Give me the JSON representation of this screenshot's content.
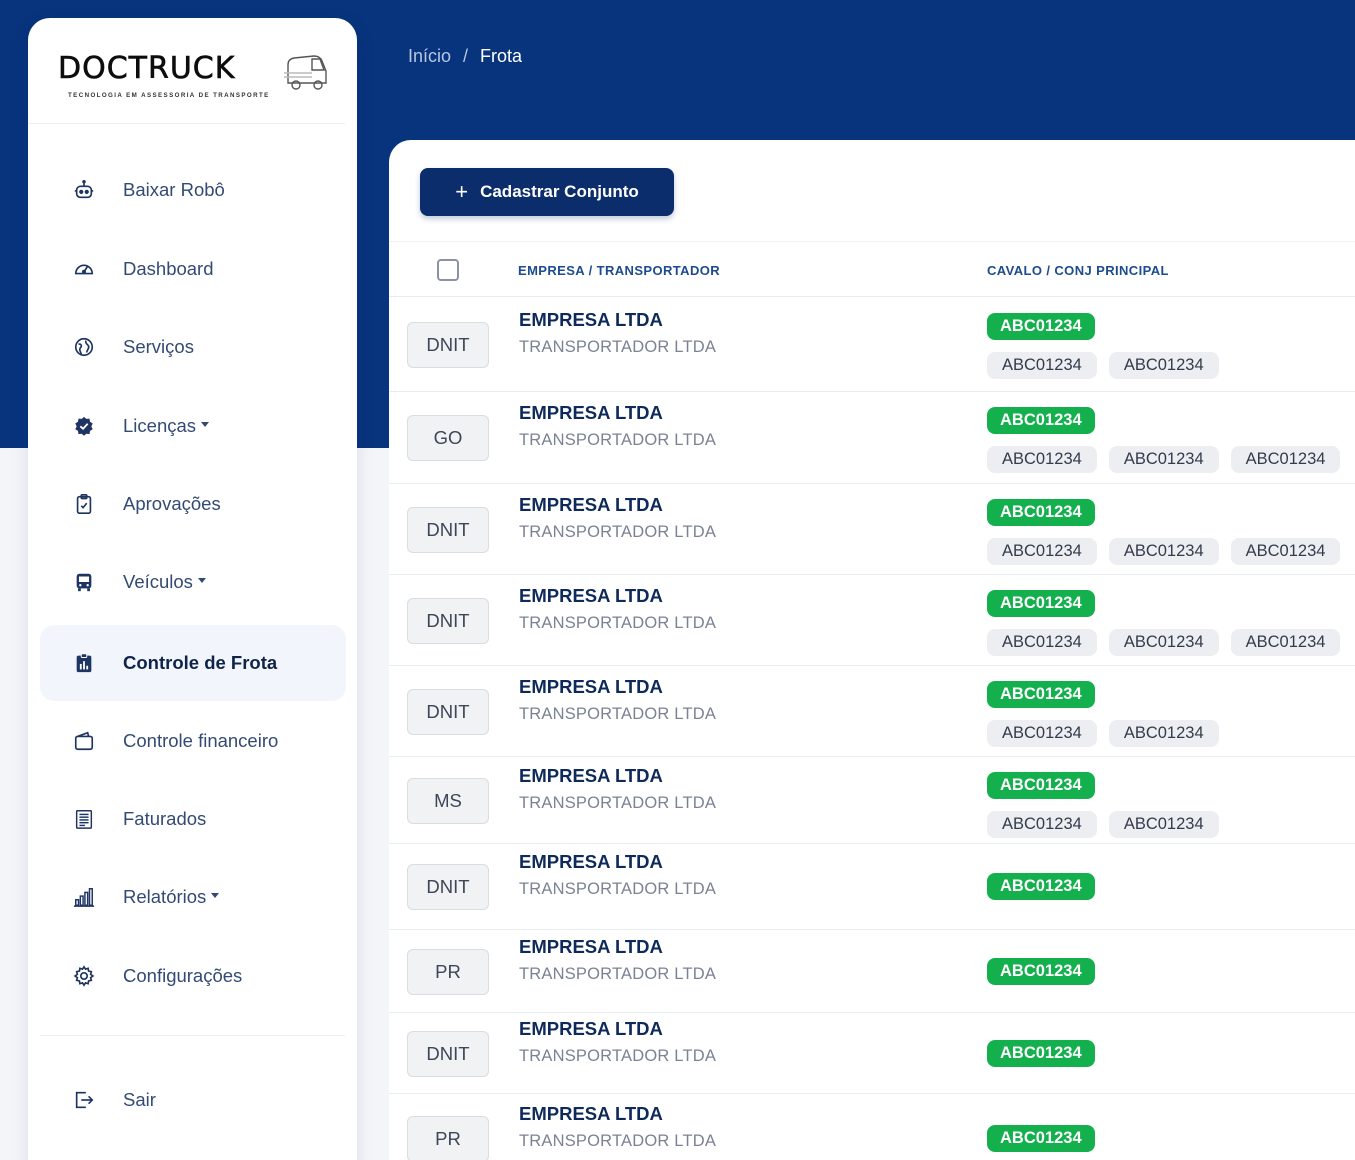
{
  "logo": {
    "name": "DOCTRUCK",
    "tagline": "TECNOLOGIA EM ASSESSORIA DE TRANSPORTE"
  },
  "breadcrumb": {
    "home": "Início",
    "separator": "/",
    "current": "Frota"
  },
  "sidebar": {
    "items": [
      {
        "label": "Baixar Robô",
        "icon": "robot-icon",
        "dropdown": false,
        "active": false
      },
      {
        "label": "Dashboard",
        "icon": "gauge-icon",
        "dropdown": false,
        "active": false
      },
      {
        "label": "Serviços",
        "icon": "globe-icon",
        "dropdown": false,
        "active": false
      },
      {
        "label": "Licenças",
        "icon": "badge-check-icon",
        "dropdown": true,
        "active": false
      },
      {
        "label": "Aprovações",
        "icon": "clipboard-check-icon",
        "dropdown": false,
        "active": false
      },
      {
        "label": "Veículos",
        "icon": "bus-icon",
        "dropdown": true,
        "active": false
      },
      {
        "label": "Controle de Frota",
        "icon": "clipboard-chart-icon",
        "dropdown": false,
        "active": true
      },
      {
        "label": "Controle financeiro",
        "icon": "wallet-icon",
        "dropdown": false,
        "active": false
      },
      {
        "label": "Faturados",
        "icon": "invoice-icon",
        "dropdown": false,
        "active": false
      },
      {
        "label": "Relatórios",
        "icon": "bar-chart-icon",
        "dropdown": true,
        "active": false
      },
      {
        "label": "Configurações",
        "icon": "gear-icon",
        "dropdown": false,
        "active": false
      }
    ],
    "logout": {
      "label": "Sair",
      "icon": "logout-icon"
    }
  },
  "toolbar": {
    "add_label": "Cadastrar Conjunto",
    "add_icon": "plus-icon"
  },
  "table": {
    "columns": [
      "EMPRESA / TRANSPORTADOR",
      "CAVALO / CONJ PRINCIPAL"
    ],
    "rows": [
      {
        "uf": "DNIT",
        "empresa": "EMPRESA LTDA",
        "transportador": "TRANSPORTADOR LTDA",
        "principal": "ABC01234",
        "conjuntos": [
          "ABC01234",
          "ABC01234"
        ]
      },
      {
        "uf": "GO",
        "empresa": "EMPRESA LTDA",
        "transportador": "TRANSPORTADOR LTDA",
        "principal": "ABC01234",
        "conjuntos": [
          "ABC01234",
          "ABC01234",
          "ABC01234"
        ]
      },
      {
        "uf": "DNIT",
        "empresa": "EMPRESA LTDA",
        "transportador": "TRANSPORTADOR LTDA",
        "principal": "ABC01234",
        "conjuntos": [
          "ABC01234",
          "ABC01234",
          "ABC01234"
        ]
      },
      {
        "uf": "DNIT",
        "empresa": "EMPRESA LTDA",
        "transportador": "TRANSPORTADOR LTDA",
        "principal": "ABC01234",
        "conjuntos": [
          "ABC01234",
          "ABC01234",
          "ABC01234"
        ]
      },
      {
        "uf": "DNIT",
        "empresa": "EMPRESA LTDA",
        "transportador": "TRANSPORTADOR LTDA",
        "principal": "ABC01234",
        "conjuntos": [
          "ABC01234",
          "ABC01234"
        ]
      },
      {
        "uf": "MS",
        "empresa": "EMPRESA LTDA",
        "transportador": "TRANSPORTADOR LTDA",
        "principal": "ABC01234",
        "conjuntos": [
          "ABC01234",
          "ABC01234"
        ]
      },
      {
        "uf": "DNIT",
        "empresa": "EMPRESA LTDA",
        "transportador": "TRANSPORTADOR LTDA",
        "principal": "ABC01234",
        "conjuntos": []
      },
      {
        "uf": "PR",
        "empresa": "EMPRESA LTDA",
        "transportador": "TRANSPORTADOR LTDA",
        "principal": "ABC01234",
        "conjuntos": []
      },
      {
        "uf": "DNIT",
        "empresa": "EMPRESA LTDA",
        "transportador": "TRANSPORTADOR LTDA",
        "principal": "ABC01234",
        "conjuntos": []
      },
      {
        "uf": "PR",
        "empresa": "EMPRESA LTDA",
        "transportador": "TRANSPORTADOR LTDA",
        "principal": "ABC01234",
        "conjuntos": []
      }
    ]
  },
  "colors": {
    "brand": "#08347d",
    "button": "#0b2d6b",
    "tag_green": "#13b04d",
    "tag_grey": "#eceef1"
  }
}
